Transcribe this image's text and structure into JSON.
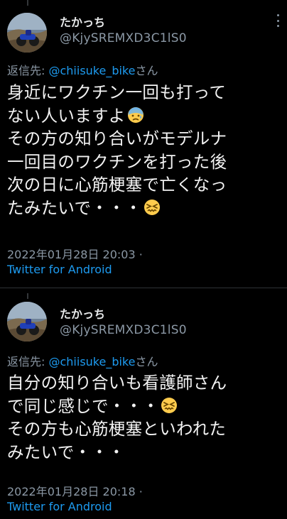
{
  "tweets": [
    {
      "display_name": "たかっち",
      "handle": "@KjySREMXD3C1lS0",
      "reply_prefix": "返信先: ",
      "reply_mention": "@chiisuke_bike",
      "reply_suffix": "さん",
      "body_lines": [
        "身近にワクチン一回も打って",
        "ない人いますよ",
        "その方の知り合いがモデルナ",
        "一回目のワクチンを打った後",
        "次の日に心筋梗塞で亡くなっ",
        "たみたいで・・・"
      ],
      "emojis": [
        "sad-sweat-emoji",
        "confounded-face-emoji"
      ],
      "timestamp": "2022年01月28日 20:03 ·",
      "source": "Twitter for Android"
    },
    {
      "display_name": "たかっち",
      "handle": "@KjySREMXD3C1lS0",
      "reply_prefix": "返信先: ",
      "reply_mention": "@chiisuke_bike",
      "reply_suffix": "さん",
      "body_lines": [
        "自分の知り合いも看護師さん",
        "で同じ感じで・・・",
        "その方も心筋梗塞といわれた",
        "みたいで・・・"
      ],
      "emojis": [
        "confounded-face-emoji"
      ],
      "timestamp": "2022年01月28日 20:18 ·",
      "source": "Twitter for Android"
    }
  ],
  "colors": {
    "background": "#000000",
    "text": "#e7e9ea",
    "secondary": "#8b98a5",
    "link": "#1d9bf0",
    "divider": "#2f3336"
  }
}
